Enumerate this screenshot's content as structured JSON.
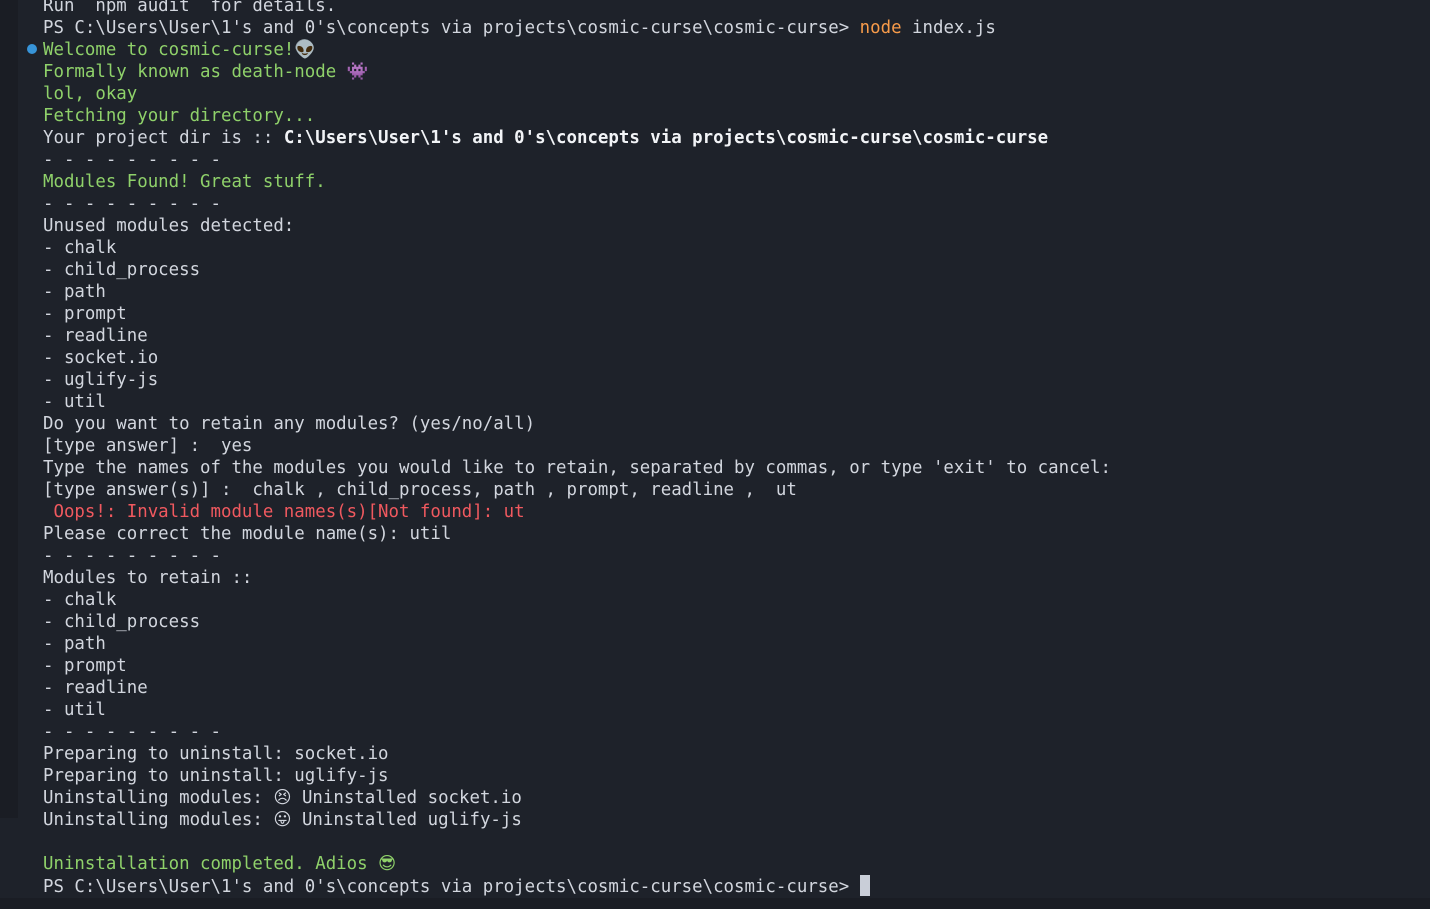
{
  "lines": {
    "l01": "Run `npm audit` for details.",
    "l02_prompt": "PS C:\\Users\\User\\1's and 0's\\concepts via projects\\cosmic-curse\\cosmic-curse> ",
    "l02_cmd": "node",
    "l02_arg": " index.js",
    "l03": "Welcome to cosmic-curse!",
    "l03_emoji": "👽",
    "l04": "Formally known as death-node ",
    "l04_emoji": "👾",
    "l05": "lol, okay",
    "l06": "Fetching your directory...",
    "l07_label": "Your project dir is :: ",
    "l07_path": "C:\\Users\\User\\1's and 0's\\concepts via projects\\cosmic-curse\\cosmic-curse",
    "l08": "- - - - - - - - -",
    "l09": "Modules Found! Great stuff.",
    "l10": "- - - - - - - - -",
    "l11": "Unused modules detected:",
    "l12": "- chalk",
    "l13": "- child_process",
    "l14": "- path",
    "l15": "- prompt",
    "l16": "- readline",
    "l17": "- socket.io",
    "l18": "- uglify-js",
    "l19": "- util",
    "l20": "Do you want to retain any modules? (yes/no/all)",
    "l21": "[type answer] :  yes",
    "l22": "Type the names of the modules you would like to retain, separated by commas, or type 'exit' to cancel:",
    "l23": "[type answer(s)] :  chalk , child_process, path , prompt, readline ,  ut",
    "l24": " Oops!: Invalid module names(s)[Not found]: ut",
    "l25": "Please correct the module name(s): util",
    "l26": "- - - - - - - - -",
    "l27": "Modules to retain ::",
    "l28": "- chalk",
    "l29": "- child_process",
    "l30": "- path",
    "l31": "- prompt",
    "l32": "- readline",
    "l33": "- util",
    "l34": "- - - - - - - - -",
    "l35": "Preparing to uninstall: socket.io",
    "l36": "Preparing to uninstall: uglify-js",
    "l37_label": "Uninstalling modules: ",
    "l37_emoji": "😣",
    "l37_text": " Uninstalled socket.io",
    "l38_label": "Uninstalling modules: ",
    "l38_emoji": "😛",
    "l38_text": " Uninstalled uglify-js",
    "l39": "",
    "l40": "Uninstallation completed. Adios ",
    "l40_emoji": "😎",
    "l41_prompt": "PS C:\\Users\\User\\1's and 0's\\concepts via projects\\cosmic-curse\\cosmic-curse> "
  },
  "colors": {
    "background": "#1e222a",
    "text": "#d2d6de",
    "success": "#8fd16a",
    "error": "#f0595f",
    "command": "#f79b4a",
    "marker": "#3794d8"
  }
}
